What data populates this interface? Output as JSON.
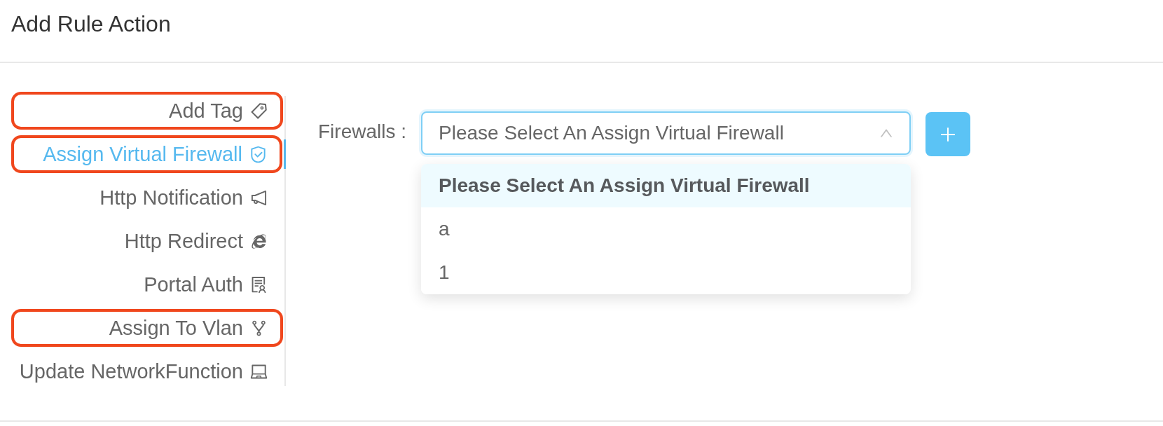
{
  "dialog": {
    "title": "Add Rule Action"
  },
  "sidebar": {
    "items": [
      {
        "label": "Add Tag",
        "selected": false,
        "highlighted": true
      },
      {
        "label": "Assign Virtual Firewall",
        "selected": true,
        "highlighted": true
      },
      {
        "label": "Http Notification",
        "selected": false,
        "highlighted": false
      },
      {
        "label": "Http Redirect",
        "selected": false,
        "highlighted": false
      },
      {
        "label": "Portal Auth",
        "selected": false,
        "highlighted": false
      },
      {
        "label": "Assign To Vlan",
        "selected": false,
        "highlighted": true
      },
      {
        "label": "Update NetworkFunction",
        "selected": false,
        "highlighted": false
      }
    ]
  },
  "form": {
    "label": "Firewalls :",
    "select": {
      "value": "Please Select An Assign Virtual Firewall",
      "expanded": true,
      "options": [
        {
          "label": "Please Select An Assign Virtual Firewall",
          "selected": true
        },
        {
          "label": "a",
          "selected": false
        },
        {
          "label": "1",
          "selected": false
        }
      ]
    }
  }
}
